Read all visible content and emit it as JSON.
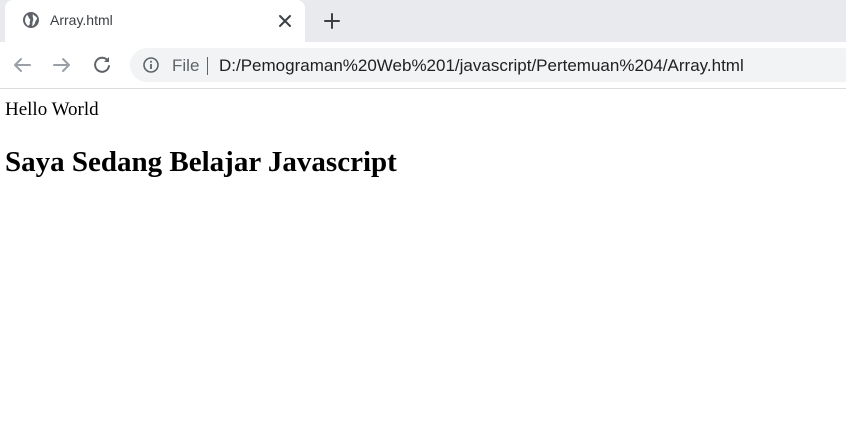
{
  "browser": {
    "tab": {
      "title": "Array.html",
      "favicon": "globe-icon",
      "close_icon": "close-icon"
    },
    "new_tab_icon": "plus-icon",
    "toolbar": {
      "back_icon": "arrow-left-icon",
      "forward_icon": "arrow-right-icon",
      "reload_icon": "reload-icon",
      "info_icon": "info-icon",
      "scheme_label": "File",
      "url": "D:/Pemograman%20Web%201/javascript/Pertemuan%204/Array.html"
    },
    "colors": {
      "tabstrip": "#e8eaed",
      "omnibox": "#f1f3f4",
      "icon": "#5f6368"
    }
  },
  "page": {
    "text_line": "Hello World",
    "heading": "Saya Sedang Belajar Javascript"
  }
}
